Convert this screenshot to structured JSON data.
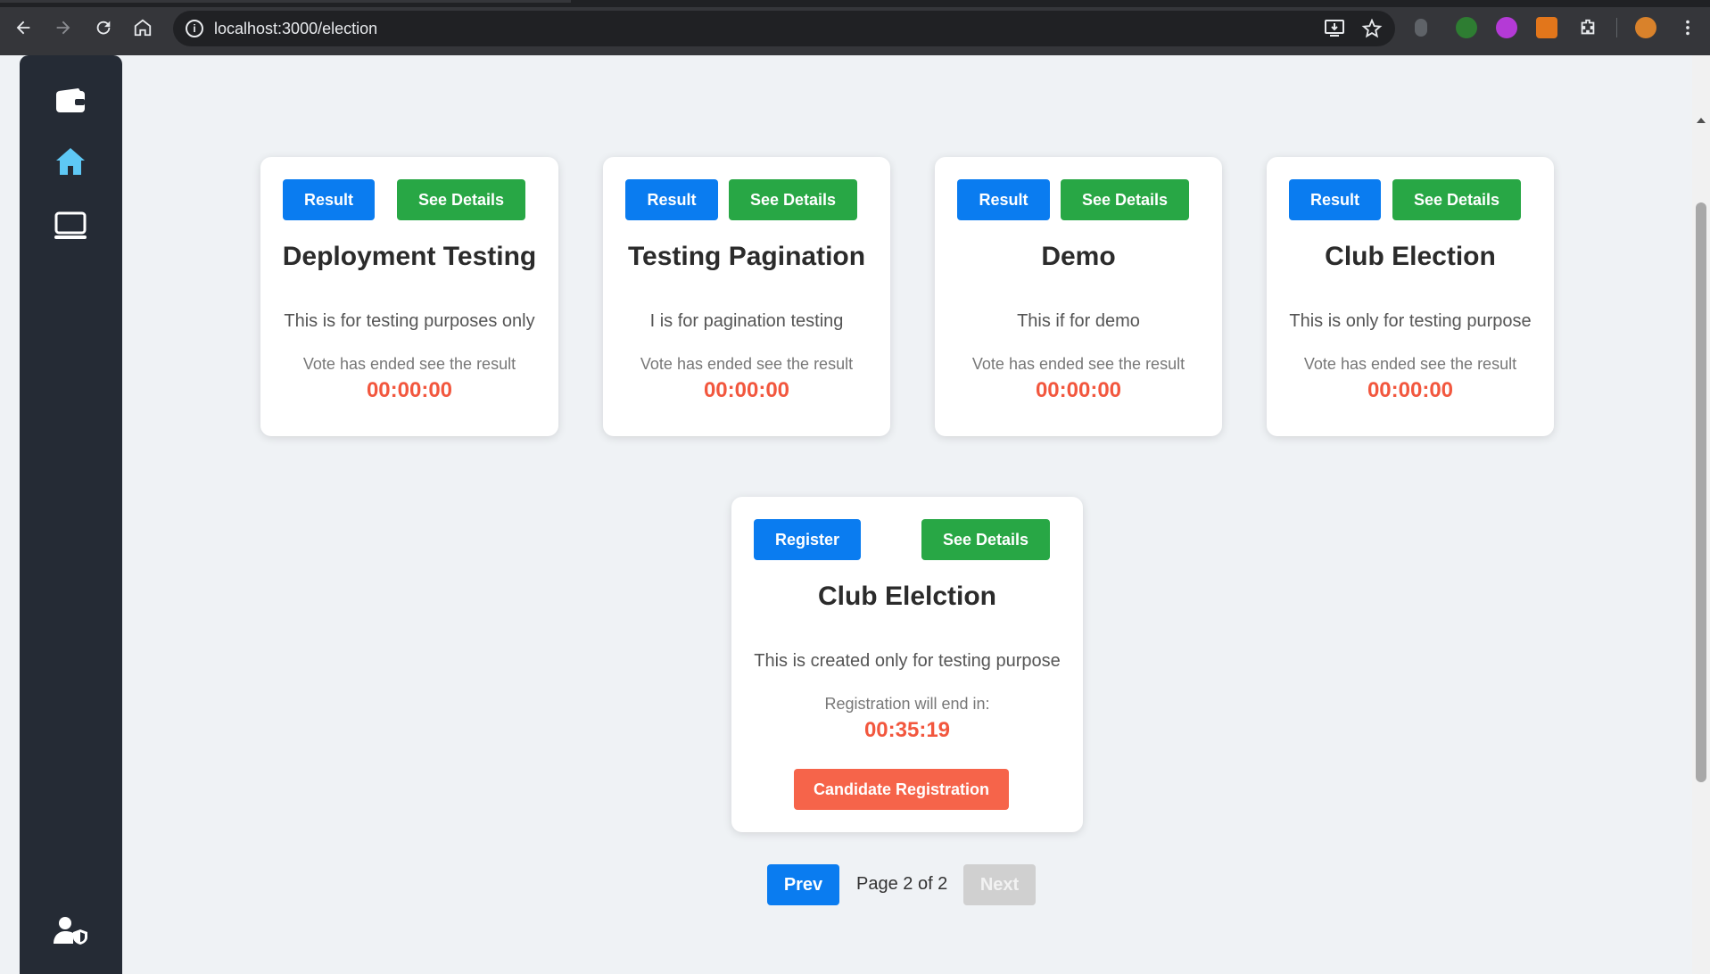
{
  "browser": {
    "url": "localhost:3000/election"
  },
  "sidebar": {
    "items": [
      {
        "icon": "wallet-icon"
      },
      {
        "icon": "home-icon",
        "active": true
      },
      {
        "icon": "monitor-icon"
      }
    ],
    "bottom_icon": "user-shield-icon"
  },
  "cards": [
    {
      "primary_label": "Result",
      "details_label": "See Details",
      "title": "Deployment Testing",
      "description": "This is for testing purposes only",
      "status": "Vote has ended see the result",
      "timer": "00:00:00"
    },
    {
      "primary_label": "Result",
      "details_label": "See Details",
      "title": "Testing Pagination",
      "description": "I is for pagination testing",
      "status": "Vote has ended see the result",
      "timer": "00:00:00"
    },
    {
      "primary_label": "Result",
      "details_label": "See Details",
      "title": "Demo",
      "description": "This if for demo",
      "status": "Vote has ended see the result",
      "timer": "00:00:00"
    },
    {
      "primary_label": "Result",
      "details_label": "See Details",
      "title": "Club Election",
      "description": "This is only for testing purpose",
      "status": "Vote has ended see the result",
      "timer": "00:00:00"
    },
    {
      "primary_label": "Register",
      "details_label": "See Details",
      "title": "Club Elelction",
      "description": "This is created only for testing purpose",
      "status": "Registration will end in:",
      "timer": "00:35:19",
      "action_label": "Candidate Registration"
    }
  ],
  "pagination": {
    "prev_label": "Prev",
    "page_label": "Page 2 of 2",
    "next_label": "Next"
  },
  "colors": {
    "primary": "#0a7cf0",
    "success": "#28a745",
    "danger": "#f6644a",
    "timer": "#f2573e",
    "sidebar_bg": "#252b35",
    "active_icon": "#5ec8f5"
  }
}
